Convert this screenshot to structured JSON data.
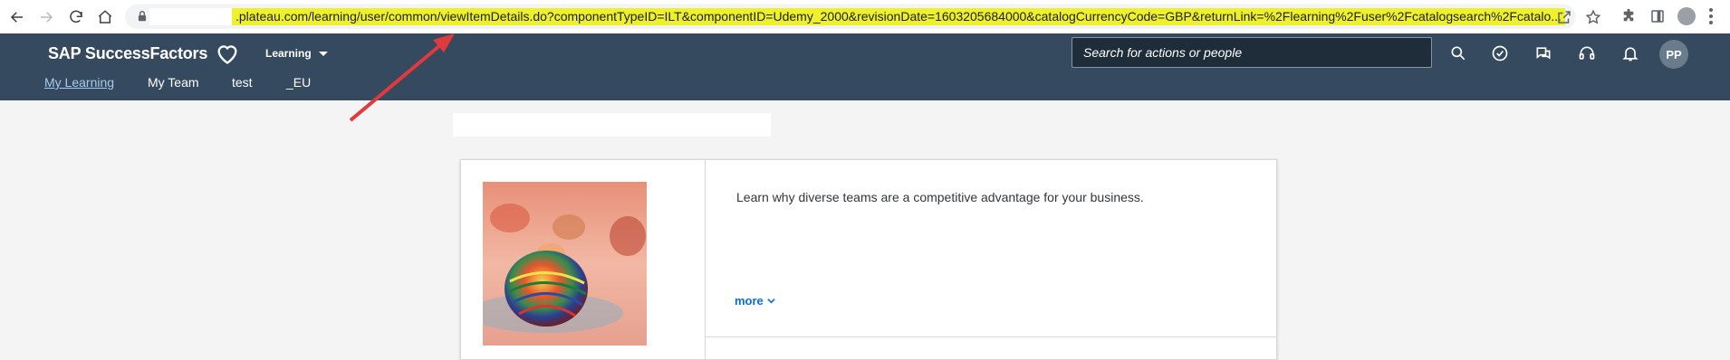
{
  "browser": {
    "url": ".plateau.com/learning/user/common/viewItemDetails.do?componentTypeID=ILT&componentID=Udemy_2000&revisionDate=1603205684000&catalogCurrencyCode=GBP&returnLink=%2Flearning%2Fuser%2Fcatalogsearch%2Fcatalo...",
    "highlight_color": "#eef02a"
  },
  "header": {
    "brand": "SAP SuccessFactors",
    "module": "Learning",
    "search_placeholder": "Search for actions or people",
    "user_initials": "PP",
    "bg_color": "#354a5f"
  },
  "subnav": {
    "items": [
      {
        "label": "My Learning",
        "active": true
      },
      {
        "label": "My Team"
      },
      {
        "label": "test"
      },
      {
        "label": "_EU"
      }
    ]
  },
  "item": {
    "description": "Learn why diverse teams are a competitive advantage for your business.",
    "more_label": "more"
  },
  "annotation": {
    "arrow_color": "#e0393e"
  }
}
